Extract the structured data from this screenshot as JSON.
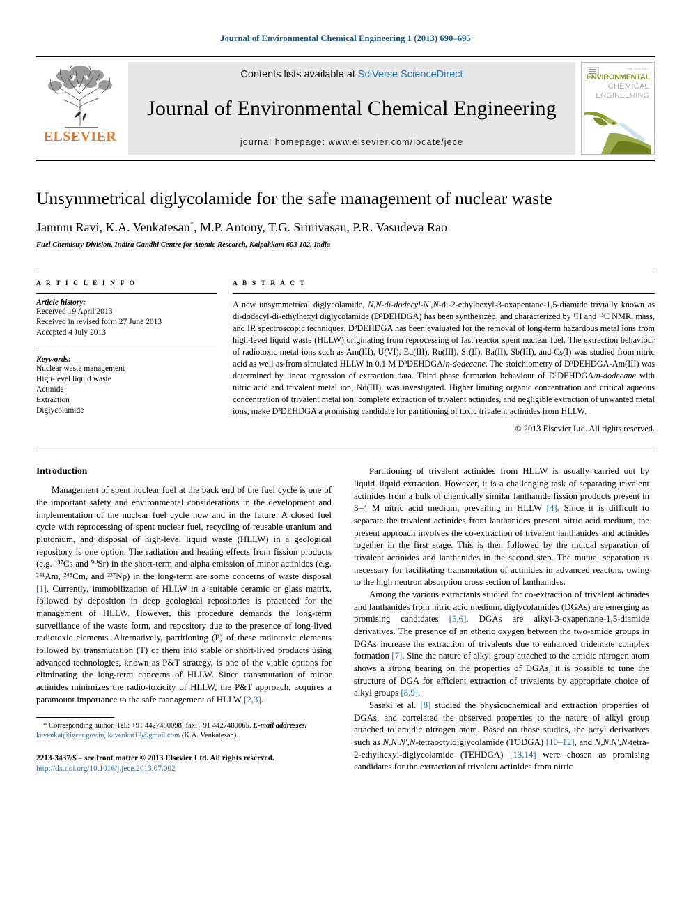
{
  "running_head": "Journal of Environmental Chemical Engineering 1 (2013) 690–695",
  "masthead": {
    "publisher_name": "ELSEVIER",
    "contents_prefix": "Contents lists available at ",
    "contents_link": "SciVerse ScienceDirect",
    "journal_name": "Journal of Environmental Chemical Engineering",
    "homepage_label": "journal homepage: www.elsevier.com/locate/jece",
    "cover": {
      "sub": "ISSN 2213-3437",
      "line1": "ENVIRONMENTAL",
      "line2": "CHEMICAL",
      "line3": "ENGINEERING"
    }
  },
  "article": {
    "title": "Unsymmetrical diglycolamide for the safe management of nuclear waste",
    "authors_pre": "Jammu Ravi, K.A. Venkatesan",
    "authors_post": ", M.P. Antony, T.G. Srinivasan, P.R. Vasudeva Rao",
    "corresponding_marker": "*",
    "affiliation": "Fuel Chemistry Division, Indira Gandhi Centre for Atomic Research, Kalpakkam 603 102, India"
  },
  "article_info": {
    "heading": "A R T I C L E   I N F O",
    "history_label": "Article history:",
    "history": [
      "Received 19 April 2013",
      "Received in revised form 27 June 2013",
      "Accepted 4 July 2013"
    ],
    "keywords_label": "Keywords:",
    "keywords": [
      "Nuclear waste management",
      "High-level liquid waste",
      "Actinide",
      "Extraction",
      "Diglycolamide"
    ]
  },
  "abstract": {
    "heading": "A B S T R A C T",
    "text": "A new unsymmetrical diglycolamide, N,N-di-dodecyl-N′,N-di-2-ethylhexyl-3-oxapentane-1,5-diamide trivially known as di-dodecyl-di-ethylhexyl diglycolamide (D³DEHDGA) has been synthesized, and characterized by ¹H and ¹³C NMR, mass, and IR spectroscopic techniques. D³DEHDGA has been evaluated for the removal of long-term hazardous metal ions from high-level liquid waste (HLLW) originating from reprocessing of fast reactor spent nuclear fuel. The extraction behaviour of radiotoxic metal ions such as Am(III), U(VI), Eu(III), Ru(III), Sr(II), Ba(II), Sb(III), and Cs(I) was studied from nitric acid as well as from simulated HLLW in 0.1 M D³DEHDGA/n-dodecane. The stoichiometry of D³DEHDGA-Am(III) was determined by linear regression of extraction data. Third phase formation behaviour of D³DEHDGA/n-dodecane with nitric acid and trivalent metal ion, Nd(III), was investigated. Higher limiting organic concentration and critical aqueous concentration of trivalent metal ion, complete extraction of trivalent actinides, and negligible extraction of unwanted metal ions, make D³DEHDGA a promising candidate for partitioning of toxic trivalent actinides from HLLW.",
    "copyright": "© 2013 Elsevier Ltd. All rights reserved."
  },
  "body": {
    "intro_heading": "Introduction",
    "left_p1": "Management of spent nuclear fuel at the back end of the fuel cycle is one of the important safety and environmental considerations in the development and implementation of the nuclear fuel cycle now and in the future. A closed fuel cycle with reprocessing of spent nuclear fuel, recycling of reusable uranium and plutonium, and disposal of high-level liquid waste (HLLW) in a geological repository is one option. The radiation and heating effects from fission products (e.g. ¹³⁷Cs and ⁹⁰Sr) in the short-term and alpha emission of minor actinides (e.g. ²⁴¹Am, ²⁴⁵Cm, and ²³⁷Np) in the long-term are some concerns of waste disposal [1]. Currently, immobilization of HLLW in a suitable ceramic or glass matrix, followed by deposition in deep geological repositories is practiced for the management of HLLW. However, this procedure demands the long-term surveillance of the waste form, and repository due to the presence of long-lived radiotoxic elements. Alternatively, partitioning (P) of these radiotoxic elements followed by transmutation (T) of them into stable or short-lived products using advanced technologies, known as P&T strategy, is one of the viable options for eliminating the long-term concerns of HLLW. Since transmutation of minor actinides minimizes the radio-toxicity of HLLW, the P&T approach, acquires a paramount importance to the safe management of HLLW [2,3].",
    "right_p1": "Partitioning of trivalent actinides from HLLW is usually carried out by liquid–liquid extraction. However, it is a challenging task of separating trivalent actinides from a bulk of chemically similar lanthanide fission products present in 3–4 M nitric acid medium, prevailing in HLLW [4]. Since it is difficult to separate the trivalent actinides from lanthanides present nitric acid medium, the present approach involves the co-extraction of trivalent lanthanides and actinides together in the first stage. This is then followed by the mutual separation of trivalent actinides and lanthanides in the second step. The mutual separation is necessary for facilitating transmutation of actinides in advanced reactors, owing to the high neutron absorption cross section of lanthanides.",
    "right_p2": "Among the various extractants studied for co-extraction of trivalent actinides and lanthanides from nitric acid medium, diglycolamides (DGAs) are emerging as promising candidates [5,6]. DGAs are alkyl-3-oxapentane-1,5-diamide derivatives. The presence of an etheric oxygen between the two-amide groups in DGAs increase the extraction of trivalents due to enhanced tridentate complex formation [7]. Sine the nature of alkyl group attached to the amidic nitrogen atom shows a strong bearing on the properties of DGAs, it is possible to tune the structure of DGA for efficient extraction of trivalents by appropriate choice of alkyl groups [8,9].",
    "right_p3": "Sasaki et al. [8] studied the physicochemical and extraction properties of DGAs, and correlated the observed properties to the nature of alkyl group attached to amidic nitrogen atom. Based on those studies, the octyl derivatives such as N,N,N′,N-tetraoctyldiglycolamide (TODGA) [10–12], and N,N,N′,N-tetra-2-ethylhexyl-diglycolamide (TEHDGA) [13,14] were chosen as promising candidates for the extraction of trivalent actinides from nitric"
  },
  "footnotes": {
    "corresponding": "* Corresponding author. Tel.: +91 4427480098; fax: +91 4427480065.",
    "email_label": "E-mail addresses:",
    "email_1": "kavenkat@igcar.gov.in",
    "email_2": "kavenkat12@gmail.com",
    "email_owner": "(K.A. Venkatesan).",
    "front_matter": "2213-3437/$ – see front matter © 2013 Elsevier Ltd. All rights reserved.",
    "doi": "http://dx.doi.org/10.1016/j.jece.2013.07.002"
  },
  "colors": {
    "link": "#1a6ea8",
    "elsevier_orange": "#e87722",
    "cover_green": "#8a9a30"
  }
}
